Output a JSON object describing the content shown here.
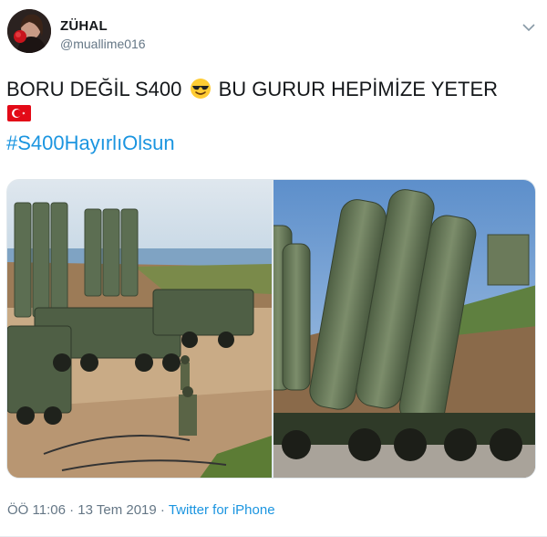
{
  "tweet": {
    "display_name": "ZÜHAL",
    "handle": "@muallime016",
    "text_part1": "BORU DEĞİL S400",
    "text_part2": "BU GURUR HEPİMİZE YETER",
    "emoji_icon": "sunglasses-emoji",
    "flag_icon": "turkey-flag",
    "hashtag": "#S400HayırlıOlsun",
    "time": "ÖÖ 11:06",
    "separator": "·",
    "date": "13 Tem 2019",
    "source": "Twitter for iPhone"
  },
  "colors": {
    "link": "#1b95e0",
    "muted": "#657786",
    "text": "#14171a"
  }
}
